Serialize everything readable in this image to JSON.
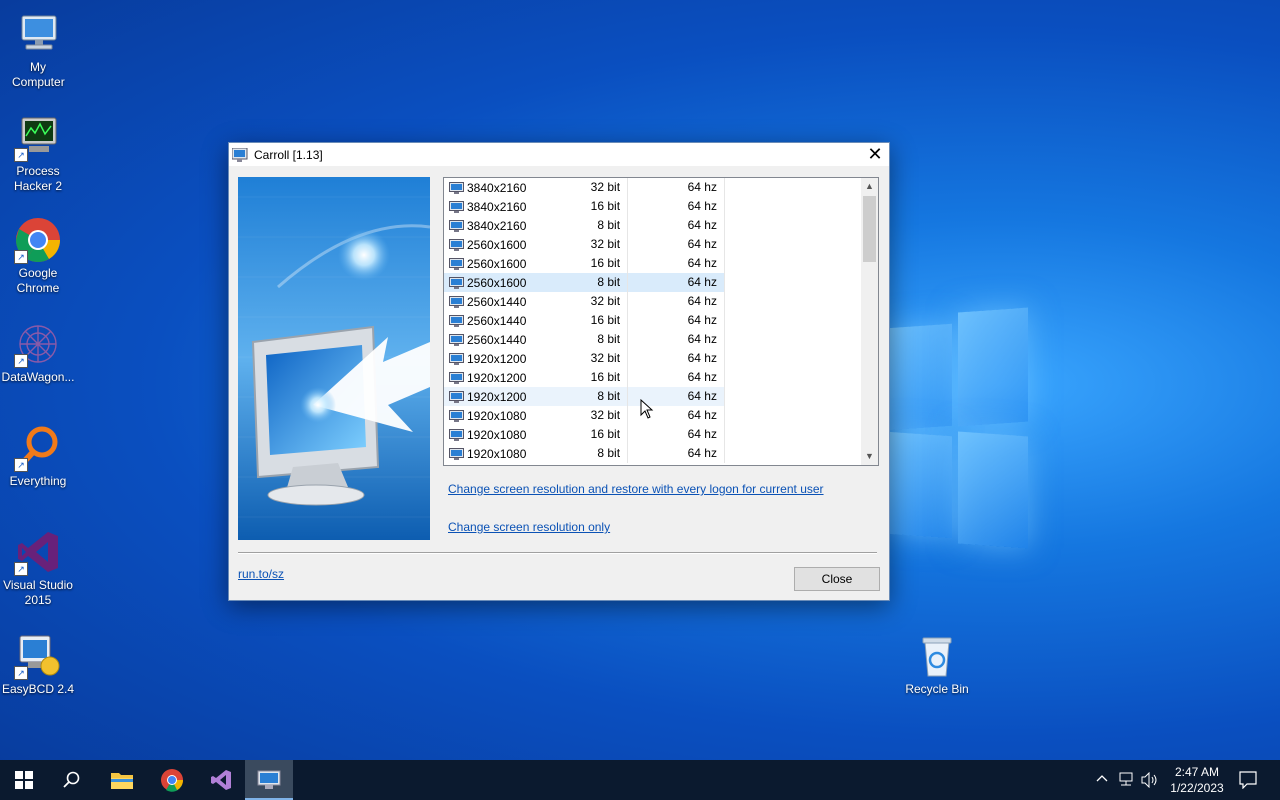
{
  "desktop": {
    "icons": [
      {
        "label": "My Computer"
      },
      {
        "label": "Process Hacker 2"
      },
      {
        "label": "Google Chrome"
      },
      {
        "label": "DataWagon..."
      },
      {
        "label": "Everything"
      },
      {
        "label": "Visual Studio 2015"
      },
      {
        "label": "EasyBCD 2.4"
      },
      {
        "label": "Recycle Bin"
      }
    ]
  },
  "dialog": {
    "title": "Carroll [1.13]",
    "close_glyph": "✕",
    "resolutions": [
      {
        "res": "3840x2160",
        "depth": "32 bit",
        "freq": "64 hz"
      },
      {
        "res": "3840x2160",
        "depth": "16 bit",
        "freq": "64 hz"
      },
      {
        "res": "3840x2160",
        "depth": "8 bit",
        "freq": "64 hz"
      },
      {
        "res": "2560x1600",
        "depth": "32 bit",
        "freq": "64 hz"
      },
      {
        "res": "2560x1600",
        "depth": "16 bit",
        "freq": "64 hz"
      },
      {
        "res": "2560x1600",
        "depth": "8 bit",
        "freq": "64 hz"
      },
      {
        "res": "2560x1440",
        "depth": "32 bit",
        "freq": "64 hz"
      },
      {
        "res": "2560x1440",
        "depth": "16 bit",
        "freq": "64 hz"
      },
      {
        "res": "2560x1440",
        "depth": "8 bit",
        "freq": "64 hz"
      },
      {
        "res": "1920x1200",
        "depth": "32 bit",
        "freq": "64 hz"
      },
      {
        "res": "1920x1200",
        "depth": "16 bit",
        "freq": "64 hz"
      },
      {
        "res": "1920x1200",
        "depth": "8 bit",
        "freq": "64 hz"
      },
      {
        "res": "1920x1080",
        "depth": "32 bit",
        "freq": "64 hz"
      },
      {
        "res": "1920x1080",
        "depth": "16 bit",
        "freq": "64 hz"
      },
      {
        "res": "1920x1080",
        "depth": "8 bit",
        "freq": "64 hz"
      }
    ],
    "selected_row": 5,
    "hover_row": 11,
    "link_restore": "Change screen resolution and restore with every logon for current user",
    "link_only": "Change screen resolution only",
    "footer_link": "run.to/sz",
    "close_button": "Close"
  },
  "taskbar": {
    "clock_time": "2:47 AM",
    "clock_date": "1/22/2023",
    "items": [
      "start-icon",
      "search-icon",
      "file-explorer-icon",
      "chrome-icon",
      "visual-studio-icon",
      "carroll-icon"
    ]
  },
  "colors": {
    "link": "#0b52b5",
    "selection": "#d9ebfb",
    "taskbar": "#0b1a2f"
  }
}
